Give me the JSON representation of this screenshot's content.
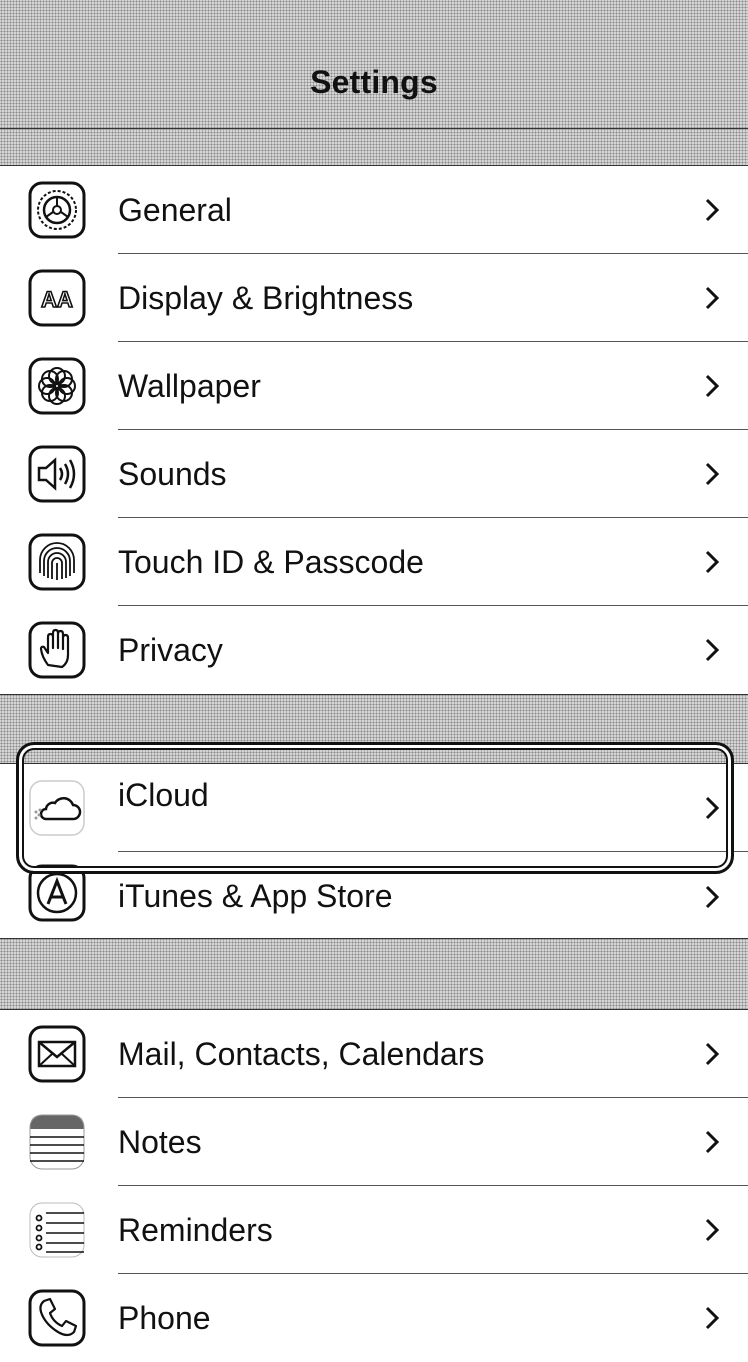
{
  "navbar": {
    "title": "Settings"
  },
  "groups": [
    {
      "items": [
        {
          "label": "General",
          "icon": "gear-icon"
        },
        {
          "label": "Display & Brightness",
          "icon": "display-brightness-icon"
        },
        {
          "label": "Wallpaper",
          "icon": "wallpaper-flower-icon"
        },
        {
          "label": "Sounds",
          "icon": "speaker-icon"
        },
        {
          "label": "Touch ID & Passcode",
          "icon": "fingerprint-icon"
        },
        {
          "label": "Privacy",
          "icon": "hand-icon"
        }
      ]
    },
    {
      "items": [
        {
          "label": "iCloud",
          "icon": "cloud-icon",
          "highlighted": true
        },
        {
          "label": "iTunes & App Store",
          "icon": "app-store-icon"
        }
      ]
    },
    {
      "items": [
        {
          "label": "Mail, Contacts, Calendars",
          "icon": "mail-icon"
        },
        {
          "label": "Notes",
          "icon": "notes-icon"
        },
        {
          "label": "Reminders",
          "icon": "reminders-icon"
        },
        {
          "label": "Phone",
          "icon": "phone-icon"
        }
      ]
    }
  ],
  "chevron_icon": "chevron-right-icon"
}
